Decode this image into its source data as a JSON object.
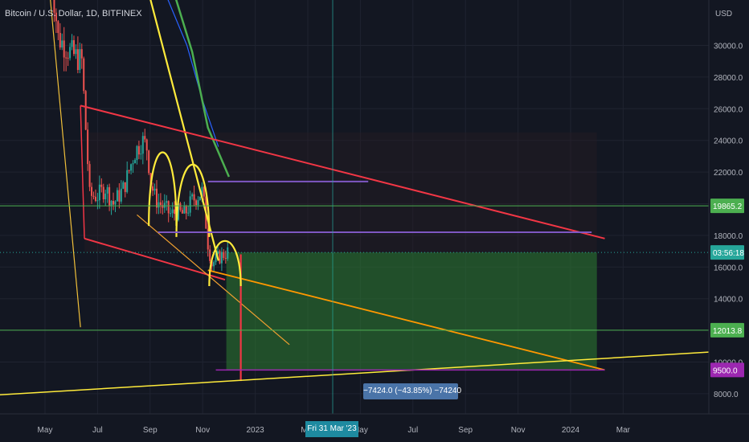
{
  "header": {
    "symbol_title": "Bitcoin / U.S. Dollar, 1D, BITFINEX"
  },
  "axis": {
    "currency": "USD",
    "price_ticks": [
      "30000.0",
      "28000.0",
      "26000.0",
      "24000.0",
      "22000.0",
      "18000.0",
      "16000.0",
      "14000.0",
      "10000.0",
      "8000.0"
    ],
    "time_ticks": [
      "May",
      "Jul",
      "Sep",
      "Nov",
      "2023",
      "Mar",
      "May",
      "Jul",
      "Sep",
      "Nov",
      "2024",
      "Mar"
    ]
  },
  "price_tags": [
    {
      "label": "19865.2",
      "color": "#4caf50",
      "kind": "horizontal-line"
    },
    {
      "label": "03:56:18",
      "color": "#26a69a",
      "kind": "countdown"
    },
    {
      "label": "12013.8",
      "color": "#4caf50",
      "kind": "horizontal-line"
    },
    {
      "label": "9500.0",
      "color": "#9c27b0",
      "kind": "target"
    }
  ],
  "crosshair": {
    "date_label": "Fri 31 Mar '23"
  },
  "measure_tool": {
    "label": "−7424.0 (−43.85%) −74240"
  },
  "colors": {
    "background": "#131722",
    "up_candle": "#26a69a",
    "down_candle": "#ef5350",
    "resistance": "#f23645",
    "support": "#ff9800",
    "yellow": "#ffeb3b",
    "ma_green": "#4caf50",
    "ma_blue": "#2962ff",
    "purple": "#9c27b0",
    "green_zone": "#2e7d32"
  },
  "chart_data": {
    "type": "candlestick",
    "title": "Bitcoin / U.S. Dollar, 1D, BITFINEX",
    "ylabel": "USD",
    "ylim": [
      7200,
      33200
    ],
    "horizontal_levels": [
      19865.2,
      12013.8,
      9500.0
    ],
    "range_box": {
      "top": 16924,
      "bottom": 9500,
      "change": -7424.0,
      "change_pct": -43.85
    },
    "price_path": [
      {
        "x": 0.0,
        "close": 38500
      },
      {
        "x": 0.5,
        "close": 30500
      },
      {
        "x": 1.0,
        "close": 29500
      },
      {
        "x": 1.4,
        "close": 29000
      },
      {
        "x": 1.7,
        "close": 20500
      },
      {
        "x": 2.0,
        "close": 20500
      },
      {
        "x": 2.3,
        "close": 21000
      },
      {
        "x": 2.6,
        "close": 20000
      },
      {
        "x": 3.0,
        "close": 21000
      },
      {
        "x": 3.4,
        "close": 23200
      },
      {
        "x": 3.7,
        "close": 24000
      },
      {
        "x": 3.9,
        "close": 23500
      },
      {
        "x": 4.0,
        "close": 21500
      },
      {
        "x": 4.2,
        "close": 20300
      },
      {
        "x": 4.5,
        "close": 19800
      },
      {
        "x": 4.8,
        "close": 19300
      },
      {
        "x": 5.0,
        "close": 19500
      },
      {
        "x": 5.3,
        "close": 19300
      },
      {
        "x": 5.6,
        "close": 20200
      },
      {
        "x": 5.8,
        "close": 20500
      },
      {
        "x": 6.0,
        "close": 20800
      },
      {
        "x": 6.2,
        "close": 17500
      },
      {
        "x": 6.35,
        "close": 16200
      },
      {
        "x": 6.6,
        "close": 16600
      },
      {
        "x": 6.8,
        "close": 16800
      },
      {
        "x": 7.0,
        "close": 17000
      }
    ]
  }
}
